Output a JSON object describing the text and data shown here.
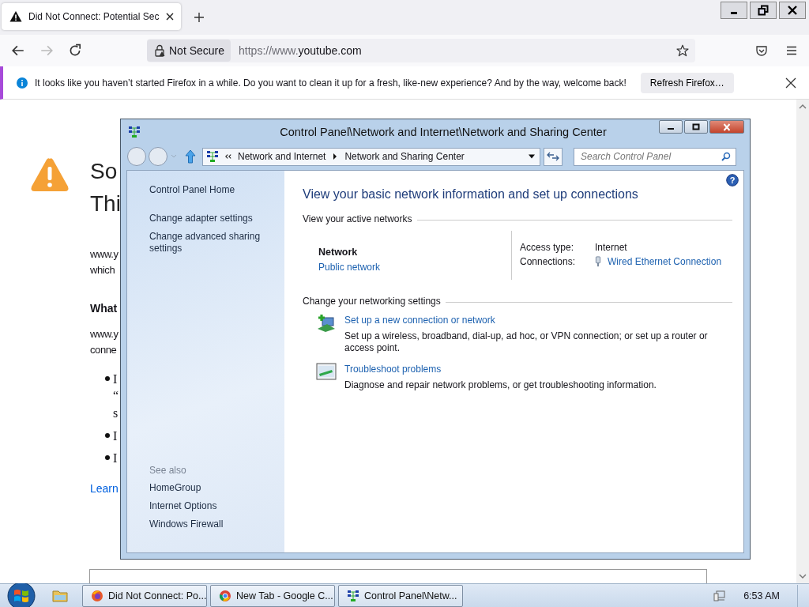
{
  "browser_tab": {
    "title": "Did Not Connect: Potential Sec"
  },
  "nav_buttons": [
    {
      "kind": "back",
      "disabled": false
    },
    {
      "kind": "forward",
      "disabled": true
    },
    {
      "kind": "reload",
      "disabled": false
    }
  ],
  "security_label": "Not Secure",
  "url": {
    "prefix": "https://www.",
    "domain": "youtube.com"
  },
  "notification": {
    "message": "It looks like you haven’t started Firefox in a while. Do you want to clean it up for a fresh, like-new experience? And by the way, welcome back!",
    "button": "Refresh Firefox…"
  },
  "error_page": {
    "title_lines": [
      "So",
      "Thi"
    ],
    "paragraph_1": [
      "www.y",
      "which"
    ],
    "subheading": "What",
    "paragraph_2": [
      "www.y",
      "conne"
    ],
    "bullets": [
      [
        "I",
        "“",
        "s"
      ],
      [
        "I"
      ],
      [
        "I"
      ]
    ],
    "link": "Learn"
  },
  "control_panel": {
    "title": "Control Panel\\Network and Internet\\Network and Sharing Center",
    "breadcrumb": [
      "Network and Internet",
      "Network and Sharing Center"
    ],
    "search_placeholder": "Search Control Panel",
    "sidebar_links": [
      "Control Panel Home",
      "Change adapter settings",
      "Change advanced sharing settings"
    ],
    "see_also_label": "See also",
    "see_also_links": [
      "HomeGroup",
      "Internet Options",
      "Windows Firewall"
    ],
    "help_glyph": "?",
    "heading": "View your basic network information and set up connections",
    "active_networks_label": "View your active networks",
    "network": {
      "name": "Network",
      "type": "Public network",
      "access_type_label": "Access type:",
      "access_type": "Internet",
      "connections_label": "Connections:",
      "connection": "Wired Ethernet Connection"
    },
    "settings_label": "Change your networking settings",
    "tasks": [
      {
        "kind": "new-connection",
        "link": "Set up a new connection or network",
        "description": "Set up a wireless, broadband, dial-up, ad hoc, or VPN connection; or set up a router or access point."
      },
      {
        "kind": "troubleshoot",
        "link": "Troubleshoot problems",
        "description": "Diagnose and repair network problems, or get troubleshooting information."
      }
    ]
  },
  "taskbar": {
    "items": [
      {
        "kind": "firefox",
        "label": "Did Not Connect: Po..."
      },
      {
        "kind": "chrome",
        "label": "New Tab - Google C..."
      },
      {
        "kind": "control-panel",
        "label": "Control Panel\\Netw..."
      }
    ],
    "clock": "6:53 AM"
  }
}
